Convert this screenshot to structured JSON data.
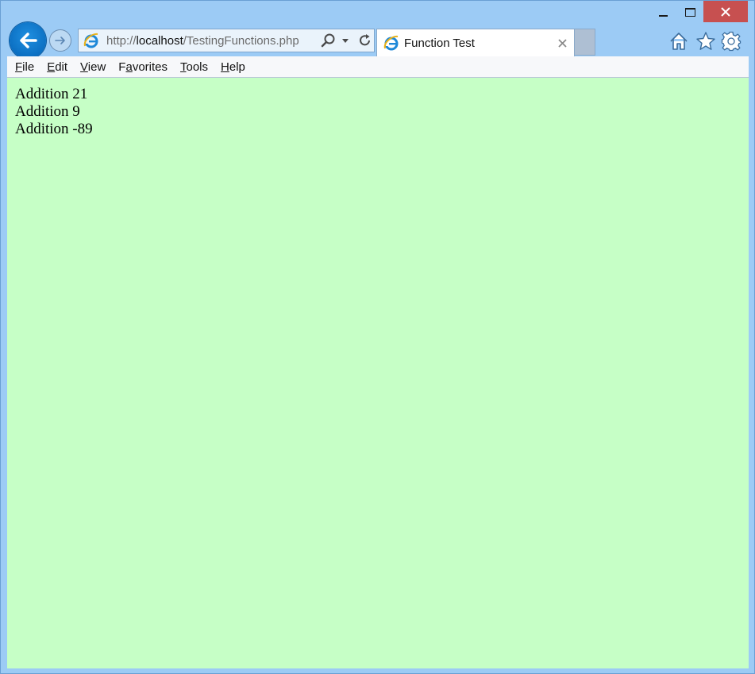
{
  "browser": {
    "address": {
      "scheme": "http://",
      "host": "localhost",
      "path": "/TestingFunctions.php"
    },
    "tab": {
      "title": "Function Test"
    },
    "icons": {
      "back": "arrow-left-icon",
      "forward": "arrow-right-icon",
      "search": "search-icon",
      "dropdown": "chevron-down-icon",
      "refresh": "refresh-icon",
      "home": "home-icon",
      "favorites": "star-icon",
      "settings": "gear-icon",
      "close_tab": "close-icon"
    },
    "colors": {
      "frame": "#9ccbf5",
      "close_button": "#c75050",
      "back_button": "#0b6fc2",
      "page_background": "#c6ffc6"
    }
  },
  "menu": {
    "items": [
      {
        "access_key": "F",
        "rest": "ile"
      },
      {
        "access_key": "E",
        "rest": "dit"
      },
      {
        "access_key": "V",
        "rest": "iew"
      },
      {
        "prefix": "F",
        "access_key": "a",
        "rest": "vorites"
      },
      {
        "access_key": "T",
        "rest": "ools"
      },
      {
        "access_key": "H",
        "rest": "elp"
      }
    ]
  },
  "page": {
    "lines": [
      "Addition 21",
      "Addition 9",
      "Addition -89"
    ]
  }
}
